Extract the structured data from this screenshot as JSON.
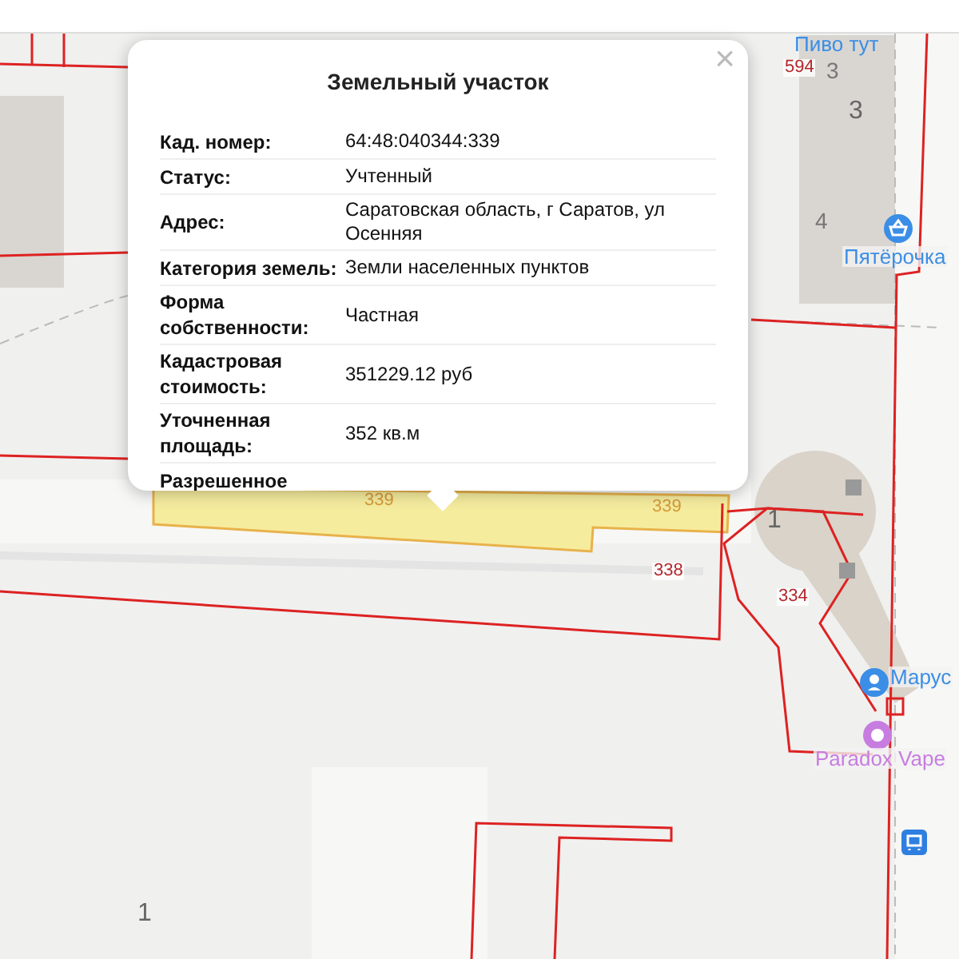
{
  "popup": {
    "title": "Земельный участок",
    "close": "×",
    "rows": [
      {
        "label": "Кад. номер:",
        "value": "64:48:040344:339"
      },
      {
        "label": "Статус:",
        "value": "Учтенный"
      },
      {
        "label": "Адрес:",
        "value": "Саратовская область, г Саратов, ул Осенняя"
      },
      {
        "label": "Категория земель:",
        "value": "Земли населенных пунктов"
      },
      {
        "label": "Форма собственности:",
        "value": "Частная"
      },
      {
        "label": "Кадастровая стоимость:",
        "value": "351229.12 руб"
      },
      {
        "label": "Уточненная площадь:",
        "value": "352 кв.м"
      },
      {
        "label": "Разрешенное"
      }
    ]
  },
  "map": {
    "labels": [
      {
        "text": "Пиво тут",
        "kind": "place"
      },
      {
        "text": "594",
        "kind": "parcel"
      },
      {
        "text": "3",
        "kind": "house"
      },
      {
        "text": "3",
        "kind": "building"
      },
      {
        "text": "4",
        "kind": "house"
      },
      {
        "text": "339",
        "kind": "selected"
      },
      {
        "text": "339",
        "kind": "selected"
      },
      {
        "text": "338",
        "kind": "parcel"
      },
      {
        "text": "1",
        "kind": "building"
      },
      {
        "text": "334",
        "kind": "parcel"
      },
      {
        "text": "1",
        "kind": "building"
      }
    ],
    "pois": [
      {
        "name": "Пятёрочка",
        "kind": "shop",
        "color": "#3b8ee6"
      },
      {
        "name": "Марус",
        "kind": "person",
        "color": "#3b8ee6"
      },
      {
        "name": "Paradox Vape",
        "kind": "ring",
        "color": "#c77de0"
      },
      {
        "kind": "transit",
        "color": "#2f7fe0"
      }
    ]
  }
}
